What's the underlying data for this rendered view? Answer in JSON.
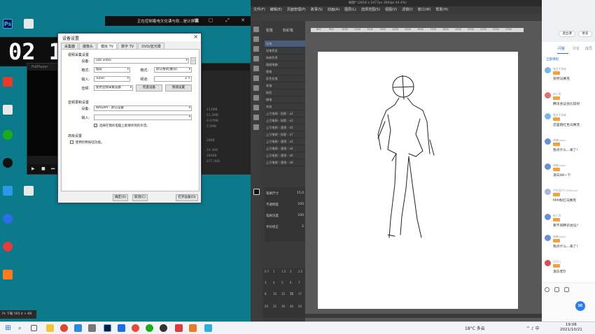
{
  "desktop": {
    "banner_text": "正在控制着电文化课与软...是计屏幕",
    "ps_icon_label": "Ps",
    "player_clock": "02 1",
    "potplayer_title": "PotPlayer",
    "potplayer_stats": [
      "112MB",
      "21.2MB",
      "6.97MB",
      "2.5MB",
      "28KB",
      "24.3KB",
      "286KB",
      "477.3KB"
    ],
    "left_status": "Ps 下载 565.4 + KB",
    "dialog": {
      "title": "设备设置",
      "tabs": [
        "采集器",
        "摄像头",
        "模拟 TV",
        "数字 TV",
        "DVD/蓝光碟"
      ],
      "active_tab": 2,
      "video_section": "视频采集设置",
      "device_label": "设备:",
      "device_value": "usb video",
      "format_label": "格式:",
      "format_value": "插软",
      "format2_label": "格式:",
      "format2_value": "默认格式(推荐)",
      "input_label": "输入:",
      "input_value": "Tuner",
      "channel_label": "频道:",
      "channel_value": "2",
      "audio_label": "音频:",
      "audio_value": "使用音频采集设备",
      "detect_button": "检查设备",
      "tune_button": "频道设置",
      "audio_section": "音频录制设置",
      "audio_device_label": "设备:",
      "audio_device_value": "WASAPI - 默认设备",
      "audio_input_label": "输入:",
      "audio_input_value": "",
      "audio_checkbox": "选择在我的电脑上能够听到的声音。",
      "advanced_section": "高级设置",
      "advanced_checkbox": "使用控制按钮功能。",
      "ok_button": "确定(O)",
      "cancel_button": "取消(C)",
      "open_button": "打开设备(O)"
    }
  },
  "taskbar": {
    "weather": "18°C 多云",
    "tray": "^ ♪ 中",
    "time": "19:08",
    "date": "2021/10/21"
  },
  "csp": {
    "title": "缩图* (2818 x 2477px 300dpi 44.4%)",
    "menu": [
      "文件(F)",
      "编辑(E)",
      "页面管理(P)",
      "故事(S)",
      "动画(A)",
      "图层(L)",
      "选择范围(S)",
      "视图(V)",
      "滤镜(I)",
      "窗口(W)",
      "帮助(H)"
    ],
    "subtool_tabs": [
      "铅笔",
      "粉彩笔"
    ],
    "brushes": [
      "铅笔",
      "铅笔色彩",
      "纯粹色系",
      "粗糙笔触",
      "细笔",
      "彩色铅笔",
      "软笔",
      "粉彩",
      "蜡笔",
      "木炭",
      "上引笔刷 - 拟影 - a2",
      "上引笔刷 - 拟影 - a3",
      "上引笔刷 - 通常 - a5",
      "上引笔刷 - 拟影 - a7",
      "上引笔刷 - 通常 - a2",
      "上引笔刷 - 通常 - a4",
      "上引笔刷 - 通常 - a6",
      "上引笔刷 - 通常 - a8"
    ],
    "props": [
      {
        "label": "笔刷尺寸",
        "value": "15.0"
      },
      {
        "label": "不透明度",
        "value": "100"
      },
      {
        "label": "笔刷浓度",
        "value": "100"
      },
      {
        "label": "手抖修正",
        "value": "2"
      }
    ],
    "ruler_ticks": [
      "800",
      "900",
      "1000",
      "1100",
      "1200",
      "1300",
      "1400",
      "1500",
      "1600",
      "1700",
      "1800",
      "1900",
      "2000",
      "2100",
      "2200",
      "2300"
    ],
    "size_labels": [
      "0.7",
      "1",
      "1.5",
      "2",
      "2.5",
      "3",
      "4",
      "5",
      "6",
      "7",
      "8",
      "10",
      "12",
      "15",
      "17",
      "20",
      "25",
      "30",
      "40",
      "50"
    ]
  },
  "live": {
    "header_buttons": [
      "退出课",
      "更多"
    ],
    "tabs": [
      "问答",
      "讨论",
      "成员"
    ],
    "active_tab": 0,
    "all_courses": "全部课程",
    "messages": [
      {
        "name": "鬼灵不再来",
        "text": "突然马赛克"
      },
      {
        "name": "新人类",
        "text": "腾讯会议会比较好"
      },
      {
        "name": "鬼灵不再来",
        "text": "还是刚红色马赛克"
      },
      {
        "name": "林檎jingle",
        "text": "我点什么...来了！"
      },
      {
        "name": "林檎jingle",
        "text": "滚白dd一下"
      },
      {
        "name": "手机用户0708tianle",
        "text": "hhh粉红马赛克"
      },
      {
        "name": "新人类",
        "text": "要不同腾讯会议？"
      },
      {
        "name": "林檎jingle",
        "text": "我点什么...来了！"
      },
      {
        "name": "叮咛儿",
        "text": "滚白老D"
      }
    ],
    "avatar_colors": [
      "#79b6e8",
      "#e07070",
      "#79b6e8",
      "#6a8fd8",
      "#6a8fd8",
      "#a6b8d8",
      "#6a8fd8",
      "#6a8fd8",
      "#e04c4c"
    ]
  }
}
